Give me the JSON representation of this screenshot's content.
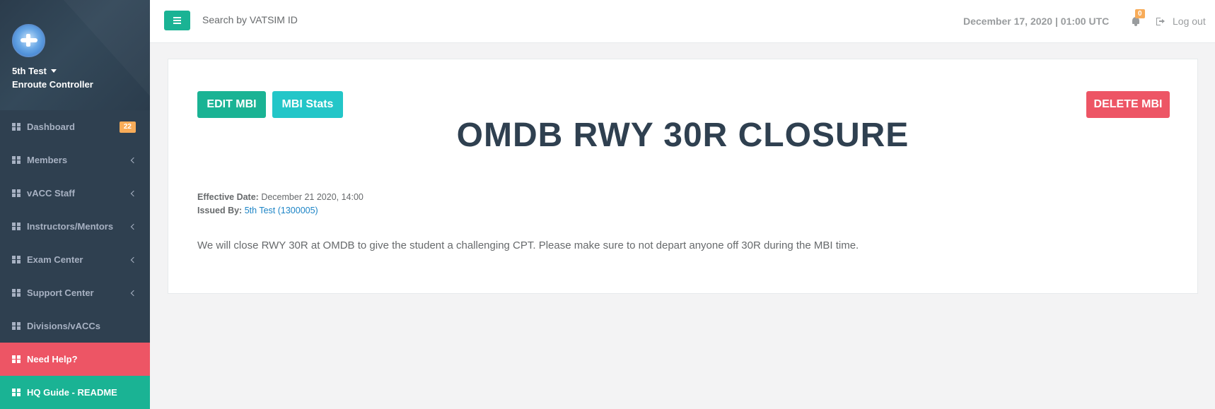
{
  "sidebar": {
    "profile": {
      "name": "5th Test",
      "role": "Enroute Controller"
    },
    "items": [
      {
        "label": "Dashboard",
        "badge": "22"
      },
      {
        "label": "Members"
      },
      {
        "label": "vACC Staff"
      },
      {
        "label": "Instructors/Mentors"
      },
      {
        "label": "Exam Center"
      },
      {
        "label": "Support Center"
      },
      {
        "label": "Divisions/vACCs"
      },
      {
        "label": "Need Help?"
      },
      {
        "label": "HQ Guide - README"
      }
    ]
  },
  "topbar": {
    "search_placeholder": "Search by VATSIM ID",
    "datetime": "December 17, 2020 | 01:00 UTC",
    "notification_count": "0",
    "logout_label": "Log out"
  },
  "mbi": {
    "edit_label": "EDIT MBI",
    "stats_label": "MBI Stats",
    "delete_label": "DELETE MBI",
    "title": "OMDB RWY 30R CLOSURE",
    "effective_label": "Effective Date:",
    "effective_value": "December 21 2020, 14:00",
    "issued_label": "Issued By:",
    "issued_value": "5th Test (1300005)",
    "description": "We will close RWY 30R at OMDB to give the student a challenging CPT. Please make sure to not depart anyone off 30R during the MBI time."
  },
  "colors": {
    "sidebar_bg": "#2f4050",
    "primary": "#1ab394",
    "info": "#23c6c8",
    "danger": "#ed5565",
    "warning": "#f8ac59",
    "link": "#1c84c6"
  }
}
